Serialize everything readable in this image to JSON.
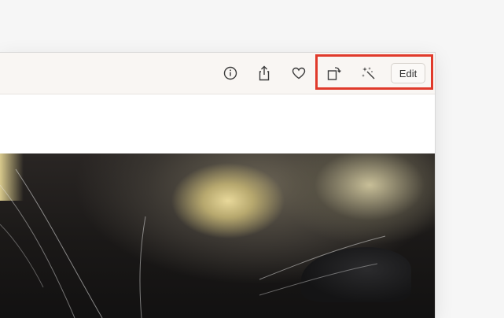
{
  "toolbar": {
    "icons": [
      "info-icon",
      "share-icon",
      "heart-icon",
      "rotate-icon",
      "magic-wand-icon"
    ],
    "edit_label": "Edit"
  },
  "colors": {
    "highlight": "#e03a2b",
    "toolbar_bg": "#f9f6f3"
  }
}
